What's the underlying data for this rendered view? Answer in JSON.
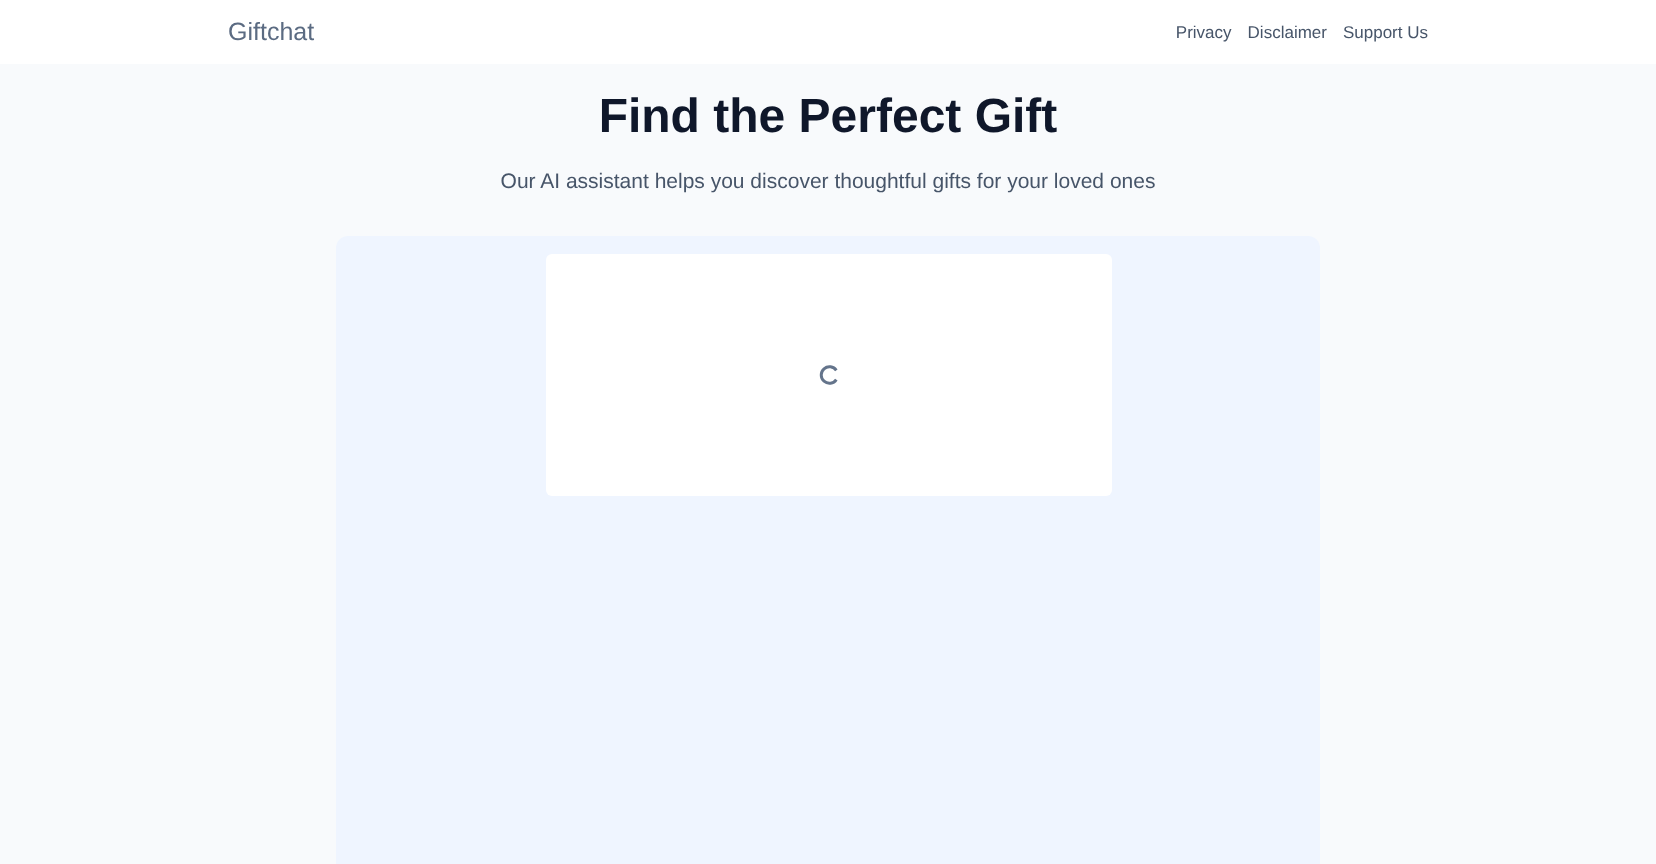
{
  "header": {
    "logo": "Giftchat",
    "nav": [
      "Privacy",
      "Disclaimer",
      "Support Us"
    ]
  },
  "hero": {
    "title": "Find the Perfect Gift",
    "subtitle": "Our AI assistant helps you discover thoughtful gifts for your loved ones"
  },
  "chat_panel": {
    "loading": true
  }
}
